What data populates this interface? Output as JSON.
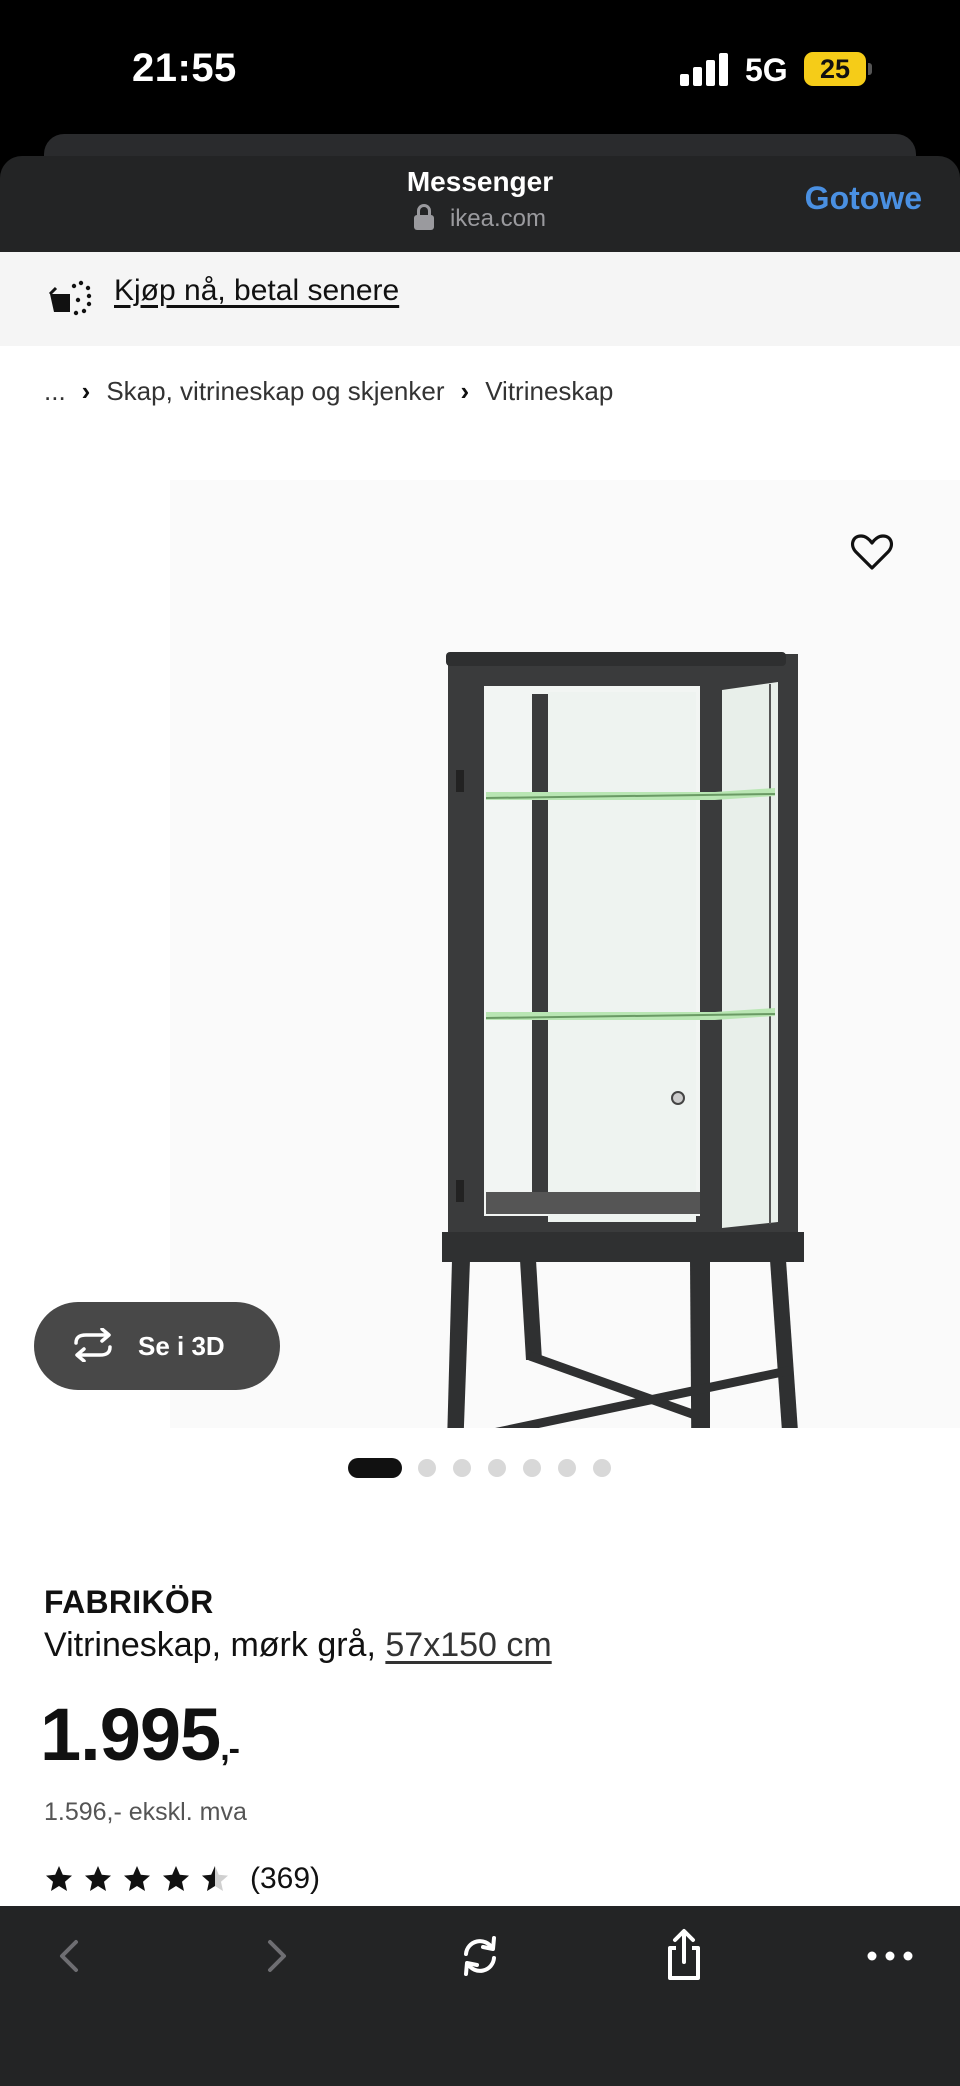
{
  "status_bar": {
    "time": "21:55",
    "network": "5G",
    "battery": "25"
  },
  "sheet": {
    "title": "Messenger",
    "url": "ikea.com",
    "done_label": "Gotowe"
  },
  "promo": {
    "text": "Kjøp nå, betal senere"
  },
  "breadcrumb": [
    "...",
    "Skap, vitrineskap og skjenker",
    "Vitrineskap"
  ],
  "gallery": {
    "view_3d_label": "Se i 3D",
    "image_count": 7,
    "active_index": 0
  },
  "product": {
    "name": "FABRIKÖR",
    "description": "Vitrineskap, mørk grå, ",
    "size": "57x150 cm",
    "price": "1.995",
    "price_suffix": ",-",
    "price_ex_vat": "1.596,- ekskl. mva",
    "rating": 4.5,
    "rating_count": "(369)"
  },
  "icons": {
    "lock": "lock-icon",
    "promo": "pay-later-icon",
    "favorite": "heart-icon",
    "rotate3d": "rotate-3d-icon",
    "back": "chevron-left-icon",
    "forward": "chevron-right-icon",
    "reload": "reload-icon",
    "share": "share-icon",
    "more": "more-icon"
  },
  "colors": {
    "accent": "#4a90e2",
    "battery": "#f5cc18",
    "cabinet": "#3a3b3c"
  }
}
